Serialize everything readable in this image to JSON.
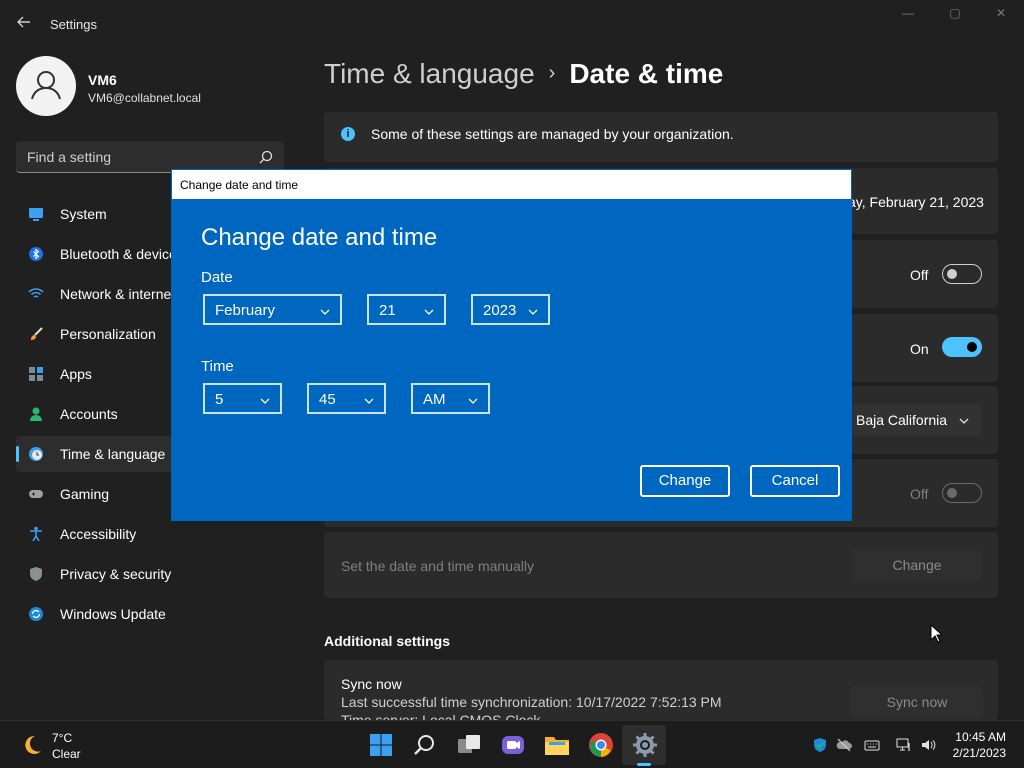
{
  "window": {
    "app_title": "Settings",
    "controls": {
      "minimize": "—",
      "maximize": "▢",
      "close": "✕"
    }
  },
  "user": {
    "name": "VM6",
    "email": "VM6@collabnet.local"
  },
  "search": {
    "placeholder": "Find a setting"
  },
  "sidebar": {
    "items": [
      {
        "label": "System",
        "icon": "monitor-icon",
        "active": false
      },
      {
        "label": "Bluetooth & devices",
        "icon": "bluetooth-icon",
        "active": false
      },
      {
        "label": "Network & internet",
        "icon": "wifi-icon",
        "active": false
      },
      {
        "label": "Personalization",
        "icon": "brush-icon",
        "active": false
      },
      {
        "label": "Apps",
        "icon": "apps-icon",
        "active": false
      },
      {
        "label": "Accounts",
        "icon": "person-icon",
        "active": false
      },
      {
        "label": "Time & language",
        "icon": "clock-globe-icon",
        "active": true
      },
      {
        "label": "Gaming",
        "icon": "gamepad-icon",
        "active": false
      },
      {
        "label": "Accessibility",
        "icon": "accessibility-icon",
        "active": false
      },
      {
        "label": "Privacy & security",
        "icon": "shield-icon",
        "active": false
      },
      {
        "label": "Windows Update",
        "icon": "update-icon",
        "active": false
      }
    ]
  },
  "breadcrumb": {
    "parent": "Time & language",
    "separator": "›",
    "current": "Date & time"
  },
  "main": {
    "info_banner": "Some of these settings are managed by your organization.",
    "current_date_text": "ay, February 21, 2023",
    "set_time_auto": {
      "state_label": "Off",
      "on": false
    },
    "set_timezone_auto": {
      "state_label": "On",
      "on": true
    },
    "timezone_value": "Baja California",
    "daylight_saving": {
      "state_label": "Off",
      "on": false,
      "disabled": true
    },
    "manual_row": {
      "label": "Set the date and time manually",
      "button": "Change"
    },
    "additional_settings_title": "Additional settings",
    "sync": {
      "title": "Sync now",
      "last_sync": "Last successful time synchronization: 10/17/2022 7:52:13 PM",
      "time_server": "Time server: Local CMOS Clock",
      "button": "Sync now"
    }
  },
  "dialog": {
    "window_title": "Change date and time",
    "heading": "Change date and time",
    "date_label": "Date",
    "month": "February",
    "day": "21",
    "year": "2023",
    "time_label": "Time",
    "hour": "5",
    "minute": "45",
    "ampm": "AM",
    "change_button": "Change",
    "cancel_button": "Cancel"
  },
  "taskbar": {
    "weather": {
      "temp": "7°C",
      "condition": "Clear",
      "icon": "moon-icon"
    },
    "apps": [
      "windows-start-icon",
      "search-icon",
      "task-view-icon",
      "chat-icon",
      "file-explorer-icon",
      "chrome-icon",
      "settings-gear-icon"
    ],
    "tray": [
      "defender-icon",
      "onedrive-icon",
      "keyboard-icon",
      "network-icon",
      "volume-icon"
    ],
    "clock": {
      "time": "10:45 AM",
      "date": "2/21/2023"
    }
  },
  "colors": {
    "accent": "#4cc2ff",
    "dialog_blue": "#0067c0",
    "background": "#202020",
    "card": "#2b2b2b"
  }
}
